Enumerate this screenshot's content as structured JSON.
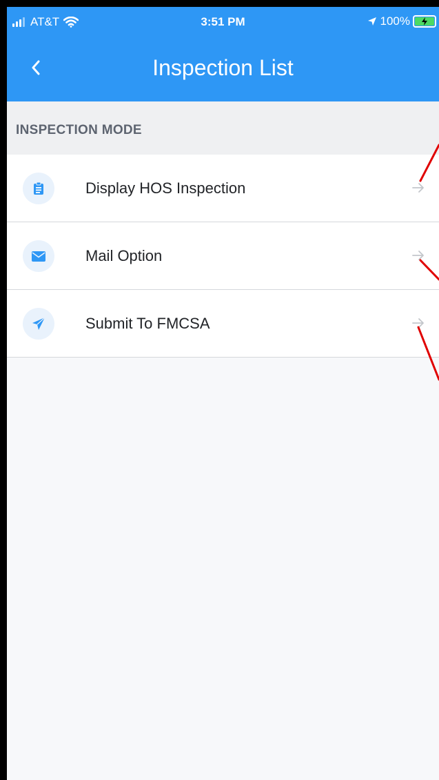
{
  "status_bar": {
    "carrier": "AT&T",
    "time": "3:51 PM",
    "battery_percent": "100%"
  },
  "nav": {
    "title": "Inspection List"
  },
  "section": {
    "title": "INSPECTION MODE"
  },
  "items": [
    {
      "label": "Display HOS Inspection",
      "icon": "clipboard-icon"
    },
    {
      "label": "Mail Option",
      "icon": "envelope-icon"
    },
    {
      "label": "Submit To FMCSA",
      "icon": "paper-plane-icon"
    }
  ],
  "colors": {
    "header_bg": "#2e97f5",
    "icon_color": "#2e97f5",
    "annotation": "#e00000"
  }
}
